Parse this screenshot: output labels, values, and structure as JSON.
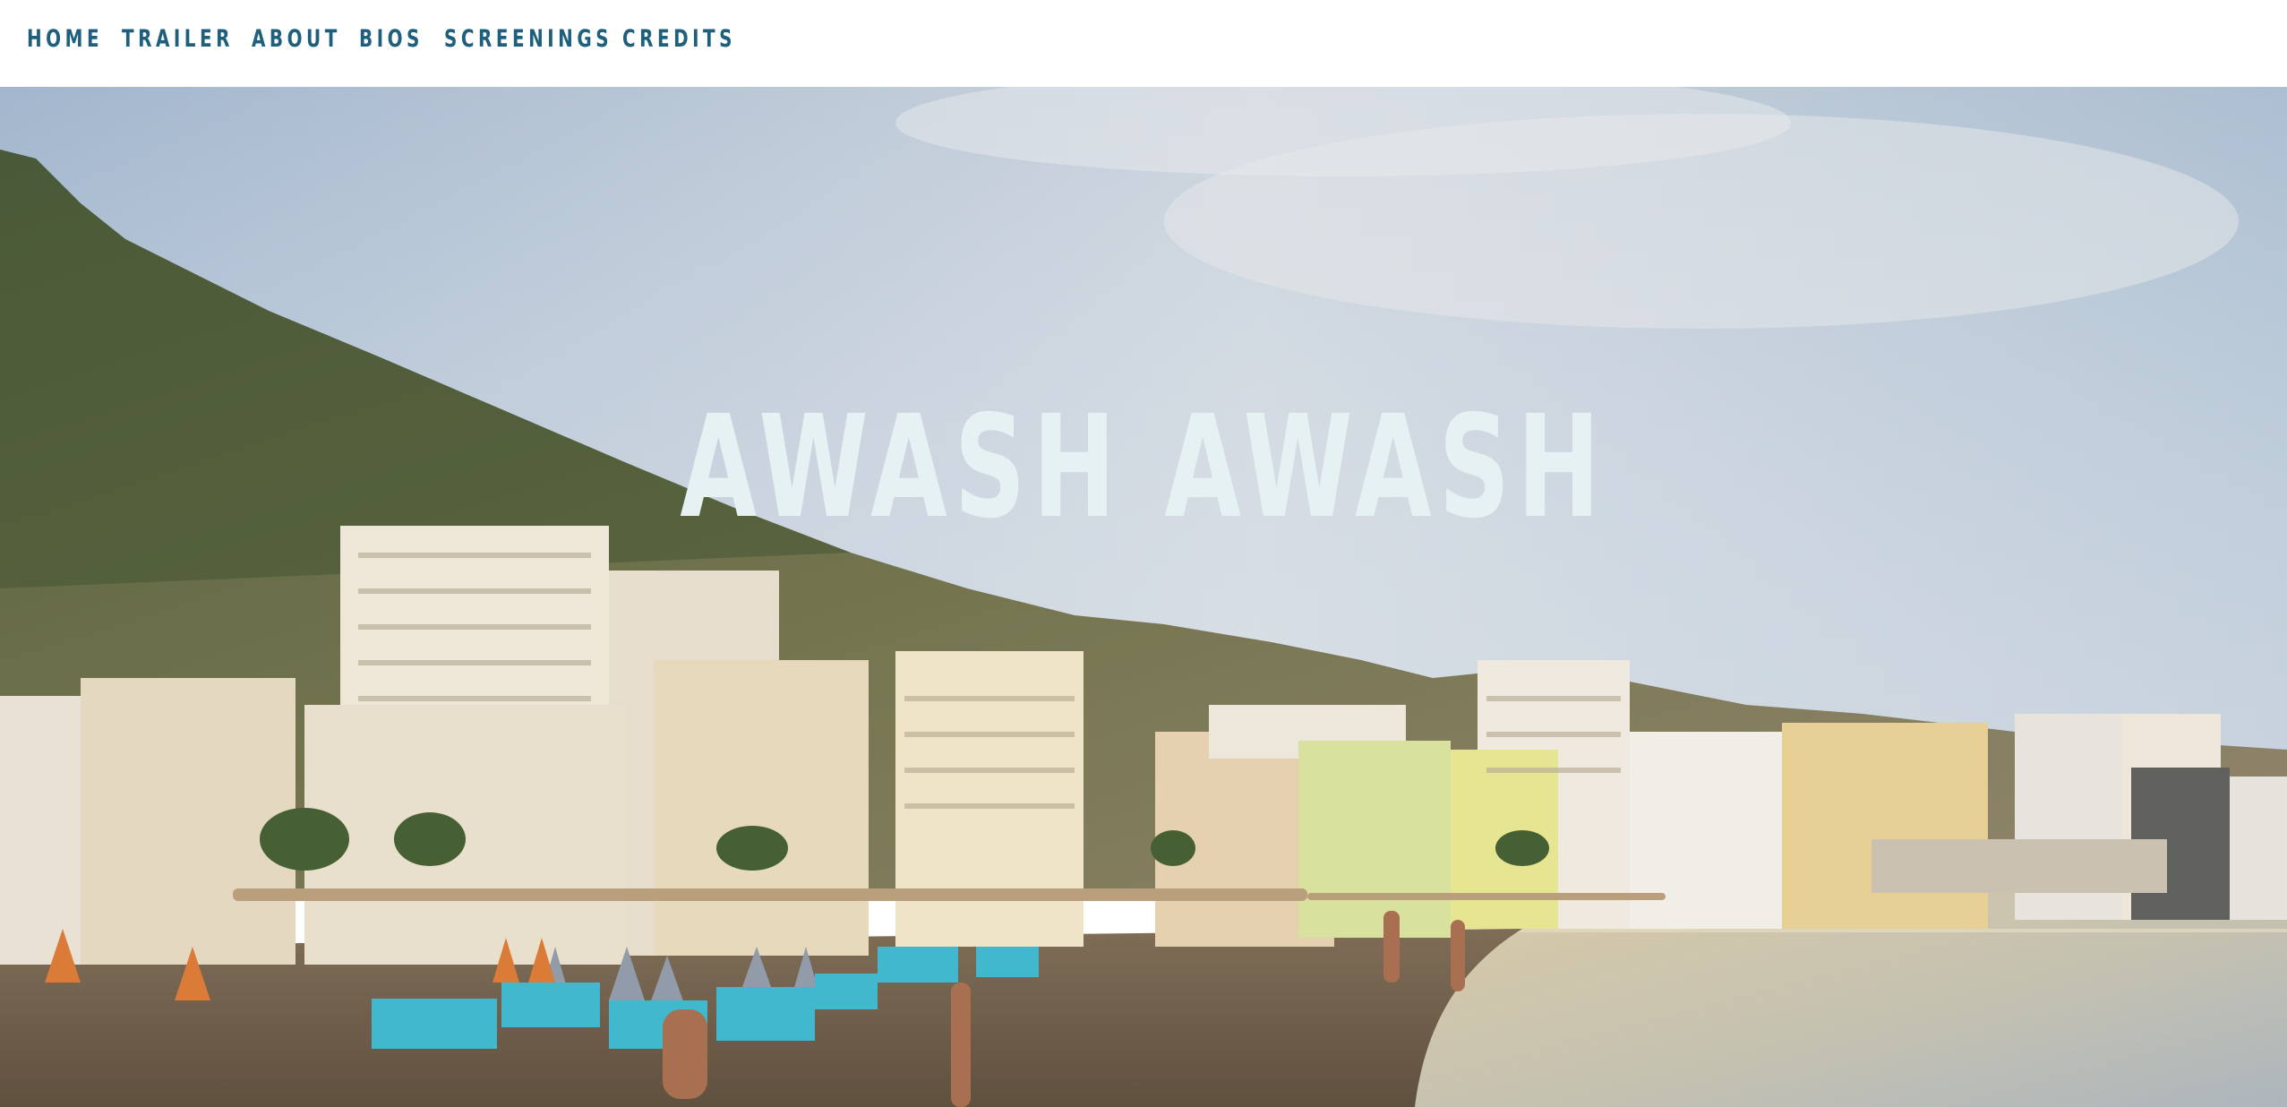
{
  "nav": {
    "items": [
      {
        "label": "HOME"
      },
      {
        "label": "TRAILER"
      },
      {
        "label": "ABOUT"
      },
      {
        "label": "BIOS"
      },
      {
        "label": "SCREENINGS"
      },
      {
        "label": "CREDITS"
      }
    ]
  },
  "hero": {
    "title": "AWASH AWASH",
    "image_description": "beach-town-photo"
  },
  "colors": {
    "nav_text": "#1d5f7c",
    "title_text": "#e6f1f3",
    "sky": "#b9c7d6",
    "sea": "#c7c0a2",
    "sand": "#6e5e49"
  }
}
